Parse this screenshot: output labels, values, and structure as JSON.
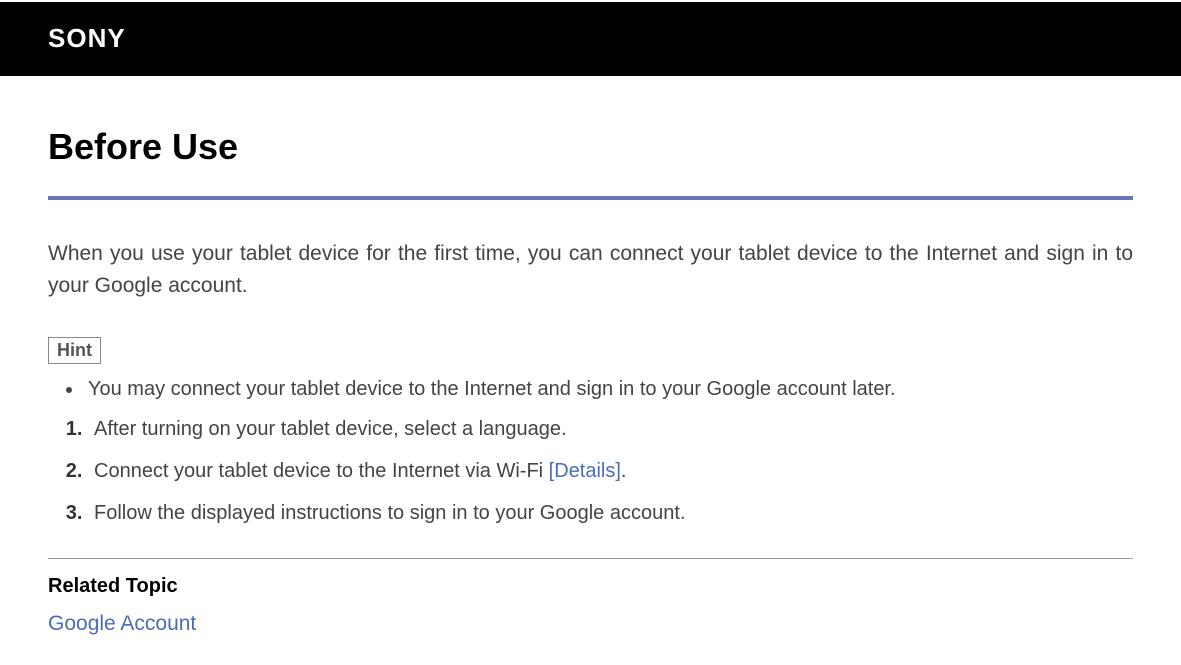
{
  "header": {
    "logo": "SONY"
  },
  "main": {
    "title": "Before Use",
    "intro": "When you use your tablet device for the first time, you can connect your tablet device to the Internet and sign in to your Google account.",
    "hint": {
      "label": "Hint",
      "items": [
        "You may connect your tablet device to the Internet and sign in to your Google account later."
      ]
    },
    "steps": [
      {
        "text": "After turning on your tablet device, select a language."
      },
      {
        "text_before": "Connect your tablet device to the Internet via Wi-Fi ",
        "link": "[Details]",
        "text_after": "."
      },
      {
        "text": "Follow the displayed instructions to sign in to your Google account."
      }
    ],
    "related": {
      "title": "Related Topic",
      "links": [
        "Google Account"
      ]
    }
  }
}
